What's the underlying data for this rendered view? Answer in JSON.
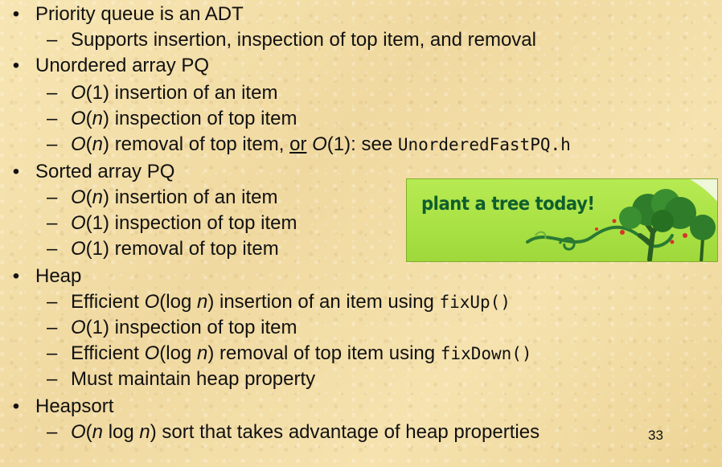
{
  "bullet_char": "•",
  "dash_char": "–",
  "items": {
    "pq": {
      "title": "Priority queue is an ADT",
      "sub1": "Supports insertion, inspection of top item, and removal"
    },
    "unordered": {
      "title": "Unordered array PQ",
      "s1": {
        "o": "O",
        "mid": "(1) insertion of an item"
      },
      "s2": {
        "o": "O",
        "p": "(",
        "n": "n",
        "rest": ") inspection of top item"
      },
      "s3": {
        "o": "O",
        "p": "(",
        "n": "n",
        "rest": ") removal of top item, ",
        "or": "or",
        "o2": "O",
        "rest2": "(1): see ",
        "code": "UnorderedFastPQ.h"
      }
    },
    "sorted": {
      "title": "Sorted array PQ",
      "s1": {
        "o": "O",
        "p": "(",
        "n": "n",
        "rest": ") insertion of an item"
      },
      "s2": {
        "o": "O",
        "rest": "(1) inspection of top item"
      },
      "s3": {
        "o": "O",
        "rest": "(1) removal of top item"
      }
    },
    "heap": {
      "title": "Heap",
      "s1": {
        "pre": "Efficient ",
        "o": "O",
        "log": "(log ",
        "n": "n",
        "rest": ") insertion of an item using ",
        "code": "fixUp()"
      },
      "s2": {
        "o": "O",
        "rest": "(1) inspection of top item"
      },
      "s3": {
        "pre": "Efficient ",
        "o": "O",
        "log": "(log ",
        "n": "n",
        "rest": ") removal of top item using ",
        "code": "fixDown()"
      },
      "s4": {
        "text": "Must maintain heap property"
      }
    },
    "heapsort": {
      "title": "Heapsort",
      "s1": {
        "o": "O",
        "p": "(",
        "n": "n",
        "log": " log ",
        "n2": "n",
        "rest": ") sort that takes advantage of heap properties"
      }
    }
  },
  "banner": {
    "text": "plant a tree today!",
    "colors": {
      "background": "#aee447",
      "text": "#0f5e2d",
      "tree": "#2f7d2a",
      "swirl": "#2a7a33",
      "berries": "#d8332a"
    }
  },
  "page_number": "33"
}
